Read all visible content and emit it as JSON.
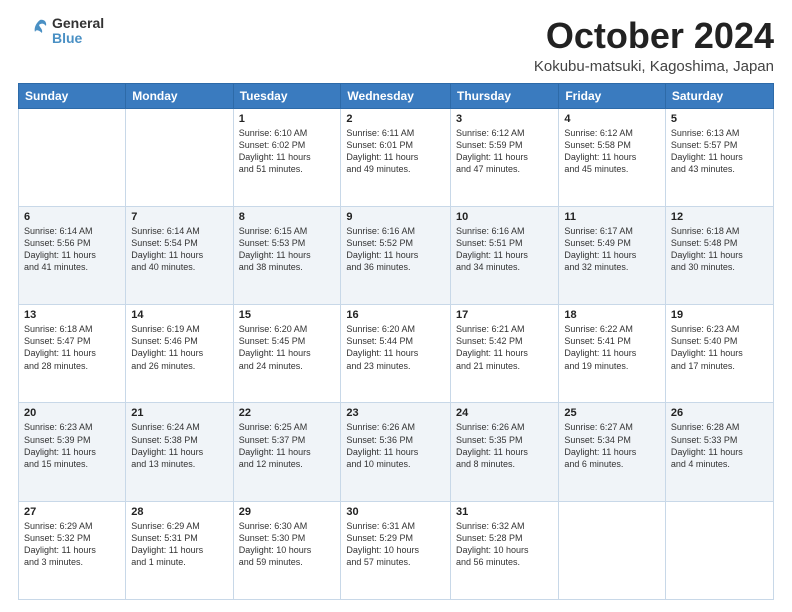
{
  "header": {
    "logo_general": "General",
    "logo_blue": "Blue",
    "title": "October 2024",
    "location": "Kokubu-matsuki, Kagoshima, Japan"
  },
  "days_of_week": [
    "Sunday",
    "Monday",
    "Tuesday",
    "Wednesday",
    "Thursday",
    "Friday",
    "Saturday"
  ],
  "weeks": [
    [
      {
        "day": "",
        "content": ""
      },
      {
        "day": "",
        "content": ""
      },
      {
        "day": "1",
        "content": "Sunrise: 6:10 AM\nSunset: 6:02 PM\nDaylight: 11 hours\nand 51 minutes."
      },
      {
        "day": "2",
        "content": "Sunrise: 6:11 AM\nSunset: 6:01 PM\nDaylight: 11 hours\nand 49 minutes."
      },
      {
        "day": "3",
        "content": "Sunrise: 6:12 AM\nSunset: 5:59 PM\nDaylight: 11 hours\nand 47 minutes."
      },
      {
        "day": "4",
        "content": "Sunrise: 6:12 AM\nSunset: 5:58 PM\nDaylight: 11 hours\nand 45 minutes."
      },
      {
        "day": "5",
        "content": "Sunrise: 6:13 AM\nSunset: 5:57 PM\nDaylight: 11 hours\nand 43 minutes."
      }
    ],
    [
      {
        "day": "6",
        "content": "Sunrise: 6:14 AM\nSunset: 5:56 PM\nDaylight: 11 hours\nand 41 minutes."
      },
      {
        "day": "7",
        "content": "Sunrise: 6:14 AM\nSunset: 5:54 PM\nDaylight: 11 hours\nand 40 minutes."
      },
      {
        "day": "8",
        "content": "Sunrise: 6:15 AM\nSunset: 5:53 PM\nDaylight: 11 hours\nand 38 minutes."
      },
      {
        "day": "9",
        "content": "Sunrise: 6:16 AM\nSunset: 5:52 PM\nDaylight: 11 hours\nand 36 minutes."
      },
      {
        "day": "10",
        "content": "Sunrise: 6:16 AM\nSunset: 5:51 PM\nDaylight: 11 hours\nand 34 minutes."
      },
      {
        "day": "11",
        "content": "Sunrise: 6:17 AM\nSunset: 5:49 PM\nDaylight: 11 hours\nand 32 minutes."
      },
      {
        "day": "12",
        "content": "Sunrise: 6:18 AM\nSunset: 5:48 PM\nDaylight: 11 hours\nand 30 minutes."
      }
    ],
    [
      {
        "day": "13",
        "content": "Sunrise: 6:18 AM\nSunset: 5:47 PM\nDaylight: 11 hours\nand 28 minutes."
      },
      {
        "day": "14",
        "content": "Sunrise: 6:19 AM\nSunset: 5:46 PM\nDaylight: 11 hours\nand 26 minutes."
      },
      {
        "day": "15",
        "content": "Sunrise: 6:20 AM\nSunset: 5:45 PM\nDaylight: 11 hours\nand 24 minutes."
      },
      {
        "day": "16",
        "content": "Sunrise: 6:20 AM\nSunset: 5:44 PM\nDaylight: 11 hours\nand 23 minutes."
      },
      {
        "day": "17",
        "content": "Sunrise: 6:21 AM\nSunset: 5:42 PM\nDaylight: 11 hours\nand 21 minutes."
      },
      {
        "day": "18",
        "content": "Sunrise: 6:22 AM\nSunset: 5:41 PM\nDaylight: 11 hours\nand 19 minutes."
      },
      {
        "day": "19",
        "content": "Sunrise: 6:23 AM\nSunset: 5:40 PM\nDaylight: 11 hours\nand 17 minutes."
      }
    ],
    [
      {
        "day": "20",
        "content": "Sunrise: 6:23 AM\nSunset: 5:39 PM\nDaylight: 11 hours\nand 15 minutes."
      },
      {
        "day": "21",
        "content": "Sunrise: 6:24 AM\nSunset: 5:38 PM\nDaylight: 11 hours\nand 13 minutes."
      },
      {
        "day": "22",
        "content": "Sunrise: 6:25 AM\nSunset: 5:37 PM\nDaylight: 11 hours\nand 12 minutes."
      },
      {
        "day": "23",
        "content": "Sunrise: 6:26 AM\nSunset: 5:36 PM\nDaylight: 11 hours\nand 10 minutes."
      },
      {
        "day": "24",
        "content": "Sunrise: 6:26 AM\nSunset: 5:35 PM\nDaylight: 11 hours\nand 8 minutes."
      },
      {
        "day": "25",
        "content": "Sunrise: 6:27 AM\nSunset: 5:34 PM\nDaylight: 11 hours\nand 6 minutes."
      },
      {
        "day": "26",
        "content": "Sunrise: 6:28 AM\nSunset: 5:33 PM\nDaylight: 11 hours\nand 4 minutes."
      }
    ],
    [
      {
        "day": "27",
        "content": "Sunrise: 6:29 AM\nSunset: 5:32 PM\nDaylight: 11 hours\nand 3 minutes."
      },
      {
        "day": "28",
        "content": "Sunrise: 6:29 AM\nSunset: 5:31 PM\nDaylight: 11 hours\nand 1 minute."
      },
      {
        "day": "29",
        "content": "Sunrise: 6:30 AM\nSunset: 5:30 PM\nDaylight: 10 hours\nand 59 minutes."
      },
      {
        "day": "30",
        "content": "Sunrise: 6:31 AM\nSunset: 5:29 PM\nDaylight: 10 hours\nand 57 minutes."
      },
      {
        "day": "31",
        "content": "Sunrise: 6:32 AM\nSunset: 5:28 PM\nDaylight: 10 hours\nand 56 minutes."
      },
      {
        "day": "",
        "content": ""
      },
      {
        "day": "",
        "content": ""
      }
    ]
  ]
}
